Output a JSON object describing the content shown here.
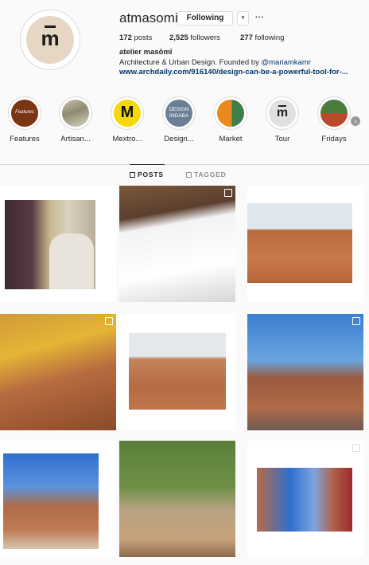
{
  "profile": {
    "username": "atmasomi",
    "follow_label": "Following",
    "dropdown_glyph": "▾",
    "more_glyph": "···",
    "posts": "172",
    "posts_label": "posts",
    "followers": "2,525",
    "followers_label": "followers",
    "following": "277",
    "following_label": "following",
    "full_name": "atelier masōmī",
    "bio_text": "Architecture & Urban Design. Founded by ",
    "bio_mention": "@mariamkamr",
    "link": "www.archdaily.com/916140/design-can-be-a-powerful-tool-for-..."
  },
  "highlights": [
    {
      "label": "Features",
      "icon": "features-cover"
    },
    {
      "label": "Artisan...",
      "icon": "artisan-cover"
    },
    {
      "label": "Mextro...",
      "icon": "mextro-logo"
    },
    {
      "label": "Design...",
      "icon": "design-indaba-logo"
    },
    {
      "label": "Market",
      "icon": "market-cover"
    },
    {
      "label": "Tour",
      "icon": "tour-logo"
    },
    {
      "label": "Fridays",
      "icon": "fridays-cover"
    }
  ],
  "highlight_texts": {
    "features": "Features",
    "mextro": "M",
    "design_indaba_1": "DESIGN",
    "design_indaba_2": "INDABA",
    "tour_glyph": "m"
  },
  "tabs": {
    "posts": "POSTS",
    "tagged": "TAGGED"
  },
  "colors": {
    "accent_link": "#00376b",
    "avatar_bg": "#e6d6c4",
    "border": "#dbdbdb",
    "mextro_yellow": "#f5d90a",
    "indaba_blue": "#6a7f95"
  }
}
